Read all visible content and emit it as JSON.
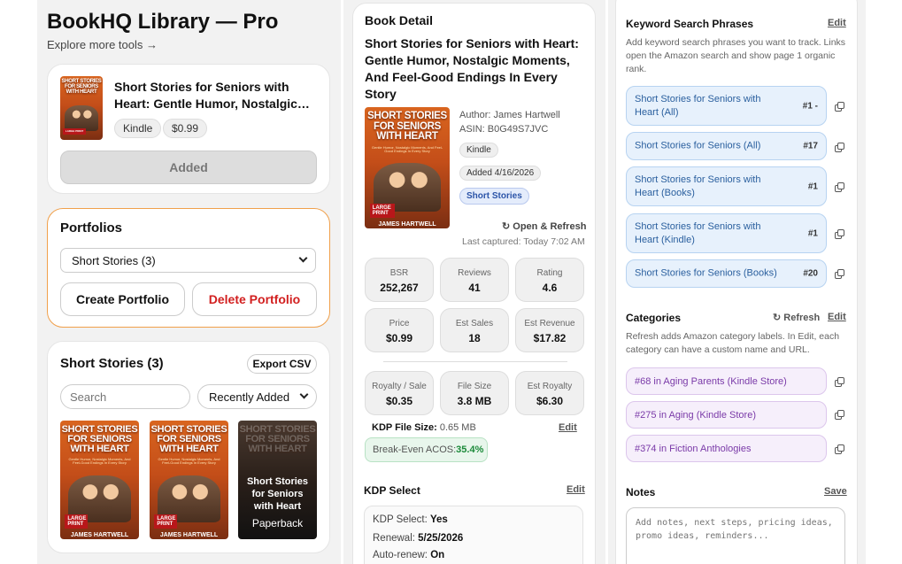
{
  "header": {
    "title": "BookHQ Library — Pro",
    "explore_link": "Explore more tools →"
  },
  "book_card": {
    "title": "Short Stories for Seniors with Heart: Gentle Humor, Nostalgic…",
    "format": "Kindle",
    "price": "$0.99",
    "added_label": "Added"
  },
  "cover": {
    "title": "SHORT STORIES FOR SENIORS WITH HEART",
    "subtitle": "Gentle Humor, Nostalgic Moments, And Feel-Good Endings In Every Story",
    "badge": "LARGE PRINT",
    "author": "JAMES HARTWELL"
  },
  "portfolios": {
    "heading": "Portfolios",
    "selected": "Short Stories (3)",
    "create_label": "Create Portfolio",
    "delete_label": "Delete Portfolio"
  },
  "collection": {
    "heading": "Short Stories (3)",
    "export_label": "Export CSV",
    "search_placeholder": "Search",
    "sort_selected": "Recently Added",
    "third_title": "Short Stories for Seniors with Heart",
    "third_format": "Paperback"
  },
  "book_detail": {
    "heading": "Book Detail",
    "title": "Short Stories for Seniors with Heart: Gentle Humor, Nostalgic Moments, And Feel-Good Endings In Every Story",
    "author": "Author: James Hartwell",
    "asin": "ASIN: B0G49S7JVC",
    "format": "Kindle",
    "added": "Added 4/16/2026",
    "category_tag": "Short Stories",
    "open_refresh": "Open & Refresh",
    "last_captured": "Last captured: Today 7:02 AM",
    "stats": [
      {
        "label": "BSR",
        "value": "252,267"
      },
      {
        "label": "Reviews",
        "value": "41"
      },
      {
        "label": "Rating",
        "value": "4.6"
      },
      {
        "label": "Price",
        "value": "$0.99"
      },
      {
        "label": "Est Sales",
        "value": "18"
      },
      {
        "label": "Est Revenue",
        "value": "$17.82"
      },
      {
        "label": "Royalty / Sale",
        "value": "$0.35"
      },
      {
        "label": "File Size",
        "value": "3.8 MB"
      },
      {
        "label": "Est Royalty",
        "value": "$6.30"
      }
    ],
    "kdp_file_size_label": "KDP File Size:",
    "kdp_file_size_value": "0.65 MB",
    "edit_label": "Edit",
    "acos_label": "Break-Even ACOS:",
    "acos_value": "35.4%"
  },
  "kdp_select": {
    "heading": "KDP Select",
    "edit_label": "Edit",
    "select_label": "KDP Select:",
    "select_value": "Yes",
    "renewal_label": "Renewal:",
    "renewal_value": "5/25/2026",
    "autorenew_label": "Auto-renew:",
    "autorenew_value": "On"
  },
  "keywords": {
    "heading": "Keyword Search Phrases",
    "edit_label": "Edit",
    "description": "Add keyword search phrases you want to track. Links open the Amazon search and show page 1 organic rank.",
    "items": [
      {
        "phrase": "Short Stories for Seniors with Heart (All)",
        "rank": "#1 -"
      },
      {
        "phrase": "Short Stories for Seniors (All)",
        "rank": "#17"
      },
      {
        "phrase": "Short Stories for Seniors with Heart (Books)",
        "rank": "#1"
      },
      {
        "phrase": "Short Stories for Seniors with Heart (Kindle)",
        "rank": "#1"
      },
      {
        "phrase": "Short Stories for Seniors (Books)",
        "rank": "#20"
      }
    ]
  },
  "categories": {
    "heading": "Categories",
    "refresh_label": "Refresh",
    "edit_label": "Edit",
    "description": "Refresh adds Amazon category labels. In Edit, each category can have a custom name and URL.",
    "items": [
      "#68 in Aging Parents (Kindle Store)",
      "#275 in Aging (Kindle Store)",
      "#374 in Fiction Anthologies"
    ]
  },
  "notes": {
    "heading": "Notes",
    "save_label": "Save",
    "placeholder": "Add notes, next steps, pricing ideas, promo ideas, reminders..."
  },
  "colors": {
    "accent_orange": "#f0a04b",
    "danger_red": "#d21f1f",
    "keyword_blue": "#2a5f9e",
    "category_purple": "#7a3aa8",
    "acos_green": "#1c8a3a"
  }
}
